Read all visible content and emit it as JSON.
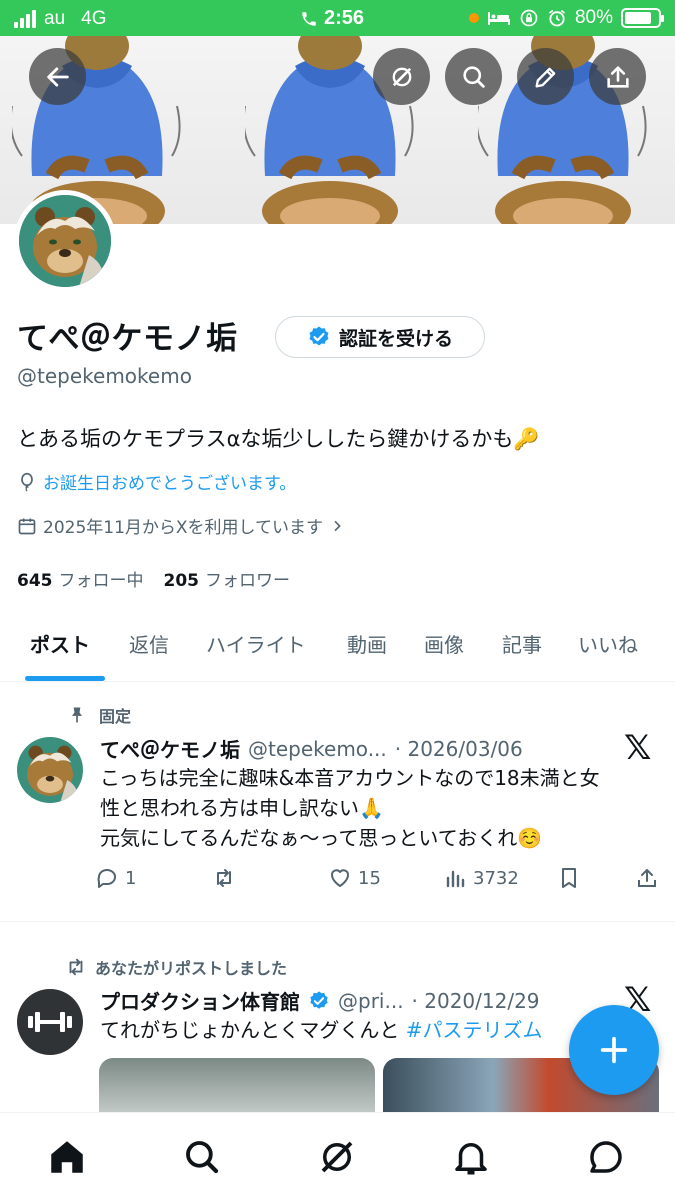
{
  "status_bar": {
    "carrier": "au",
    "network": "4G",
    "time": "2:56",
    "battery": "80%"
  },
  "profile": {
    "display_name": "てぺ＠ケモノ垢",
    "verify_button": "認証を受ける",
    "handle": "@tepekemokemo",
    "bio": "とある垢のケモプラスαな垢少ししたら鍵かけるかも🔑",
    "birthday": "お誕生日おめでとうございます。",
    "joined": "2025年11月からXを利用しています",
    "following_count": "645",
    "following_label": "フォロー中",
    "followers_count": "205",
    "followers_label": "フォロワー"
  },
  "tabs": [
    {
      "label": "ポスト"
    },
    {
      "label": "返信"
    },
    {
      "label": "ハイライト"
    },
    {
      "label": "動画"
    },
    {
      "label": "画像"
    },
    {
      "label": "記事"
    },
    {
      "label": "いいね"
    }
  ],
  "posts": [
    {
      "context": "固定",
      "name": "てぺ＠ケモノ垢",
      "handle": "@tepekemo...",
      "date": "· 2026/03/06",
      "lines": [
        "こっちは完全に趣味&本音アカウントなので18未満と女",
        "性と思われる方は申し訳ない🙏",
        "元気にしてるんだなぁ～って思っといておくれ☺️"
      ],
      "replies": "1",
      "likes": "15",
      "views": "3732"
    },
    {
      "context": "あなたがリポストしました",
      "name": "プロダクション体育館",
      "handle": "@pri...",
      "date": "· 2020/12/29",
      "text": "てれがちじょかんとくマグくんと",
      "hashtag": "#パステリズム"
    }
  ],
  "colors": {
    "accent": "#1d9bf0",
    "status_bar": "#34c759",
    "text": "#0f1419",
    "muted": "#536471"
  },
  "icons": [
    "back-arrow-icon",
    "grok-icon",
    "search-icon",
    "edit-pencil-icon",
    "share-icon",
    "verified-badge-icon",
    "balloon-icon",
    "calendar-icon",
    "chevron-right-icon",
    "pin-icon",
    "x-logo-icon",
    "reply-icon",
    "repost-icon",
    "like-icon",
    "views-icon",
    "bookmark-icon",
    "plus-icon",
    "home-icon",
    "notifications-icon",
    "messages-icon"
  ]
}
